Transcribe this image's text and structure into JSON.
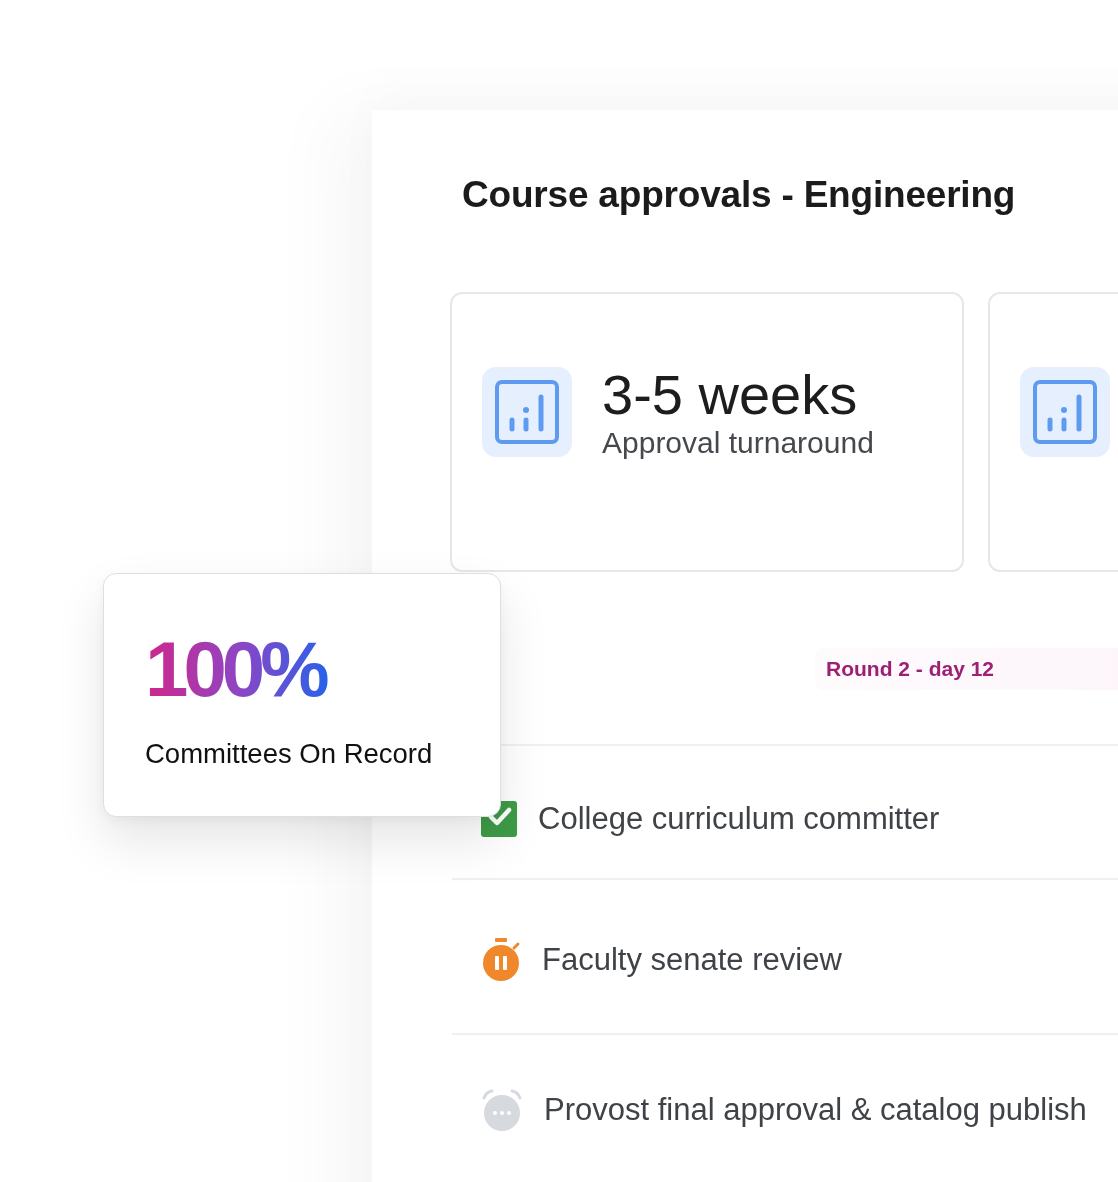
{
  "title": "Course approvals - Engineering",
  "stat_cards": [
    {
      "kind": "stat",
      "value": "3-5 weeks",
      "label": "Approval turnaround"
    },
    {
      "kind": "stat"
    }
  ],
  "status_badge": "Round 2 - day 12",
  "steps": [
    {
      "kind": "done",
      "label": "College curriculum committer"
    },
    {
      "kind": "paused",
      "label": "Faculty senate review"
    },
    {
      "kind": "pending",
      "label": "Provost final approval & catalog publish"
    }
  ],
  "summary_card": {
    "value": "100%",
    "label": "Committees On Record"
  }
}
